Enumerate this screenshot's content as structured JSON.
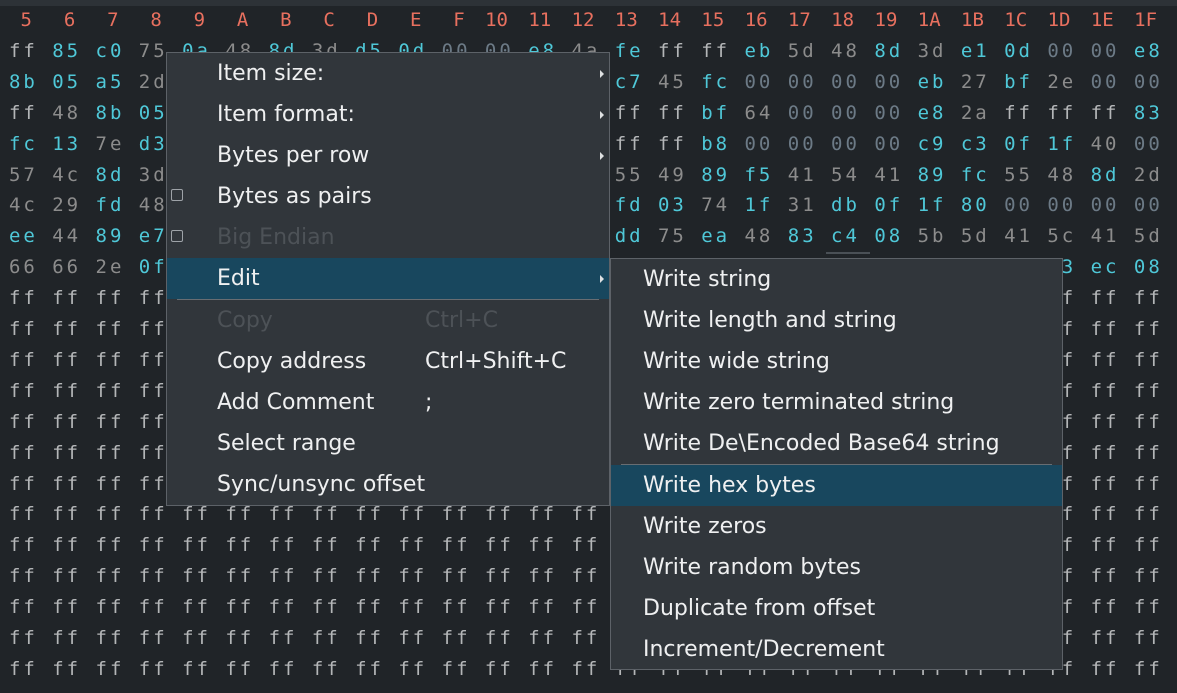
{
  "hex": {
    "column_headers": [
      "5",
      "6",
      "7",
      "8",
      "9",
      "A",
      "B",
      "C",
      "D",
      "E",
      "F",
      "10",
      "11",
      "12",
      "13",
      "14",
      "15",
      "16",
      "17",
      "18",
      "19",
      "1A",
      "1B",
      "1C",
      "1D",
      "1E",
      "1F"
    ],
    "rows": [
      "ff 85 c0 75 0a 48 8d 3d d5 0d 00 00 e8 4a fe ff ff eb 5d 48 8d 3d e1 0d 00 00 e8",
      "8b 05 a5 2d -- -- -- -- -- -- -- -- -- -- c7 45 fc 00 00 00 00 eb 27 bf 2e 00 00",
      "ff 48 8b 05 -- -- -- -- -- -- -- -- -- -- ff ff bf 64 00 00 00 e8 2a ff ff ff 83",
      "fc 13 7e d3 -- -- -- -- -- -- -- -- -- -- ff ff b8 00 00 00 00 c9 c3 0f 1f 40 00",
      "57 4c 8d 3d -- -- -- -- -- -- -- -- -- -- 55 49 89 f5 41 54 41 89 fc 55 48 8d 2d",
      "4c 29 fd 48 -- -- -- -- -- -- -- -- -- -- fd 03 74 1f 31 db 0f 1f 80 00 00 00 00",
      "ee 44 89 e7 -- -- -- -- -- -- -- -- -- -- dd 75 ea 48 83 c4 08 5b 5d 41 5c 41 5d",
      "66 66 2e 0f -- -- -- -- -- -- -- -- -- -- -- -- -- -- -- -- -- -- -- -- 83 ec 08",
      "ff ff ff ff ff ff ff ff ff ff ff ff ff ff ff ff ff ff ff ff ff ff ff ff ff ff ff",
      "ff ff ff ff ff ff ff ff ff ff ff ff ff ff ff ff ff ff ff ff ff ff ff ff ff ff ff",
      "ff ff ff ff ff ff ff ff ff ff ff ff ff ff ff ff ff ff ff ff ff ff ff ff ff ff ff",
      "ff ff ff ff ff ff ff ff ff ff ff ff ff ff ff ff ff ff ff ff ff ff ff ff ff ff ff",
      "ff ff ff ff ff ff ff ff ff ff ff ff ff ff ff ff ff ff ff ff ff ff ff ff ff ff ff",
      "ff ff ff ff ff ff ff ff ff ff ff ff ff ff ff ff ff ff ff ff ff ff ff ff ff ff ff",
      "ff ff ff ff ff ff ff ff ff ff ff ff ff ff ff ff ff ff ff ff ff ff ff ff ff ff ff",
      "ff ff ff ff ff ff ff ff ff ff ff ff ff ff ff ff ff ff ff ff ff ff ff ff ff ff ff",
      "ff ff ff ff ff ff ff ff ff ff ff ff ff ff ff ff ff ff ff ff ff ff ff ff ff ff ff",
      "ff ff ff ff ff ff ff ff ff ff ff ff ff ff ff ff ff ff ff ff ff ff ff ff ff ff ff",
      "ff ff ff ff ff ff ff ff ff ff ff ff ff ff ff ff ff ff ff ff ff ff ff ff ff ff ff",
      "ff ff ff ff ff ff ff ff ff ff ff ff ff ff ff ff ff ff ff ff ff ff ff ff ff ff ff",
      "ff ff ff ff ff ff ff ff ff ff ff ff ff ff ff ff ff ff ff ff ff ff ff ff ff ff ff"
    ],
    "colors": {
      "header": "#e8705f",
      "zero": "#6c7a86",
      "ff": "#b4b6b8",
      "printable": "#8c8c8c",
      "other": "#4fc8d8"
    }
  },
  "context_menu": {
    "item_size": "Item size:",
    "item_format": "Item format:",
    "bytes_per_row": "Bytes per row",
    "bytes_as_pairs": "Bytes as pairs",
    "big_endian": "Big Endian",
    "edit": "Edit",
    "copy": "Copy",
    "copy_shortcut": "Ctrl+C",
    "copy_address": "Copy address",
    "copy_address_shortcut": "Ctrl+Shift+C",
    "add_comment": "Add Comment",
    "add_comment_shortcut": ";",
    "select_range": "Select range",
    "sync_offset": "Sync/unsync offset"
  },
  "edit_submenu": {
    "items": [
      "Write string",
      "Write length and string",
      "Write wide string",
      "Write zero terminated string",
      "Write De\\Encoded Base64 string",
      "Write hex bytes",
      "Write zeros",
      "Write random bytes",
      "Duplicate from offset",
      "Increment/Decrement"
    ],
    "highlighted": "Write hex bytes"
  }
}
